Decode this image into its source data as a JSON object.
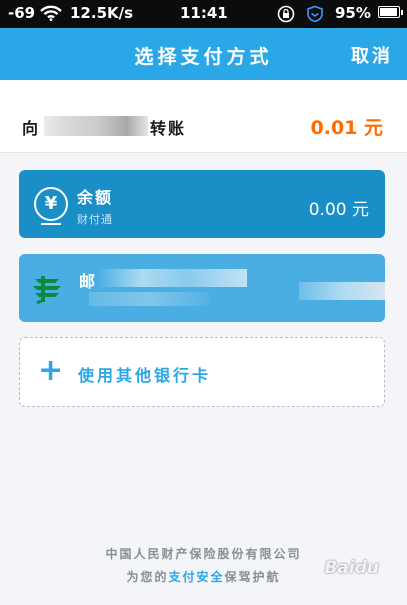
{
  "status_bar": {
    "signal": "-69",
    "speed": "12.5K/s",
    "time": "11:41",
    "battery": "95%",
    "battery_level": 0.95
  },
  "title_bar": {
    "title": "选择支付方式",
    "cancel_label": "取消"
  },
  "transfer": {
    "prefix": "向",
    "suffix": "转账",
    "amount": "0.01 元"
  },
  "payment_methods": {
    "balance": {
      "name": "余额",
      "provider": "财付通",
      "amount": "0.00 元"
    },
    "bank": {
      "name": "邮"
    },
    "add_card_label": "使用其他银行卡"
  },
  "footer": {
    "line1": "中国人民财产保险股份有限公司",
    "line2_before": "为您的",
    "line2_highlight": "支付安全",
    "line2_after": "保驾护航"
  },
  "watermark": "Baidu",
  "colors": {
    "primary": "#2aa7e6",
    "amount": "#ff6d00",
    "balance_card": "#1a8fc7",
    "bank_card": "#4aaee2"
  }
}
